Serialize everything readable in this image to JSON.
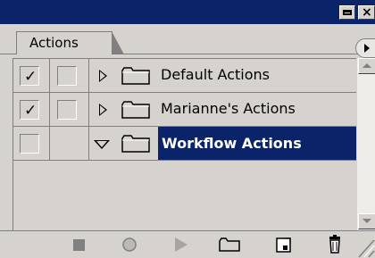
{
  "panel": {
    "tab_label": "Actions"
  },
  "actions": [
    {
      "label": "Default Actions",
      "checked": true,
      "dialog": false,
      "expanded": false,
      "selected": false
    },
    {
      "label": "Marianne's Actions",
      "checked": true,
      "dialog": false,
      "expanded": false,
      "selected": false
    },
    {
      "label": "Workflow Actions",
      "checked": false,
      "dialog": false,
      "expanded": true,
      "selected": true
    }
  ],
  "colors": {
    "titlebar": "#0b2469",
    "panel_bg": "#d6d3ce",
    "selection": "#0b2469",
    "icon_gray": "#808080"
  },
  "toolbar": {
    "icons": [
      "stop-icon",
      "record-icon",
      "play-icon",
      "new-set-icon",
      "new-action-icon",
      "delete-icon"
    ]
  }
}
